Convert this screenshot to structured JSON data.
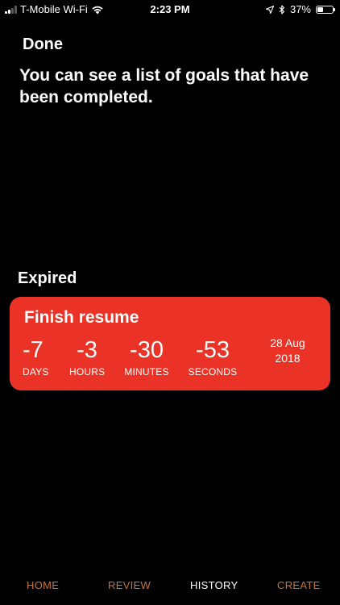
{
  "status_bar": {
    "carrier": "T-Mobile Wi-Fi",
    "time": "2:23 PM",
    "battery_percent": "37%",
    "battery_level": 0.37,
    "icons": [
      "signal-icon",
      "wifi-icon",
      "location-arrow-icon",
      "bluetooth-icon",
      "battery-icon"
    ]
  },
  "done": {
    "title": "Done",
    "description": "You can see a list of goals that have been completed."
  },
  "expired": {
    "title": "Expired",
    "goals": [
      {
        "title": "Finish resume",
        "days": "-7",
        "days_label": "DAYS",
        "hours": "-3",
        "hours_label": "HOURS",
        "minutes": "-30",
        "minutes_label": "MINUTES",
        "seconds": "-53",
        "seconds_label": "SECONDS",
        "date_line1": "28 Aug",
        "date_line2": "2018",
        "color": "#ea3326"
      }
    ]
  },
  "tabs": [
    {
      "label": "HOME",
      "active": false
    },
    {
      "label": "REVIEW",
      "active": false
    },
    {
      "label": "HISTORY",
      "active": true
    },
    {
      "label": "CREATE",
      "active": false
    }
  ],
  "colors": {
    "background": "#000000",
    "accent": "#c6763a",
    "expired_card": "#ea3326",
    "text": "#ffffff"
  }
}
